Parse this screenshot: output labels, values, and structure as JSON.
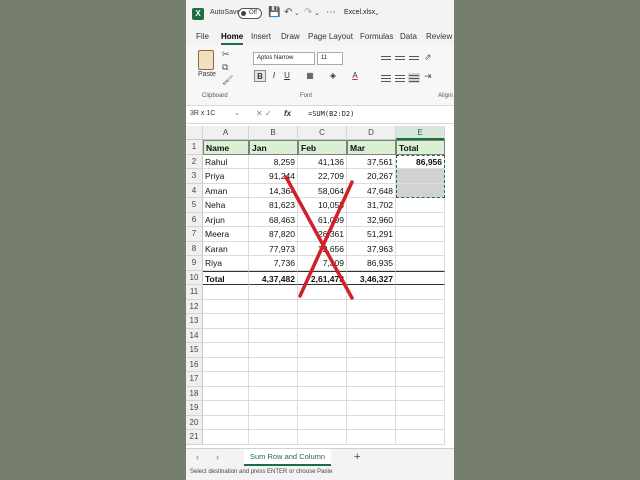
{
  "titlebar": {
    "autosave_label": "AutoSave",
    "toggle_state": "Off",
    "filename": "Excel.xlsx"
  },
  "menu": {
    "items": [
      "File",
      "Home",
      "Insert",
      "Draw",
      "Page Layout",
      "Formulas",
      "Data",
      "Review"
    ],
    "active": "Home"
  },
  "ribbon": {
    "paste_label": "Paste",
    "font_name": "Aptos Narrow",
    "font_size": "11",
    "groups": [
      "Clipboard",
      "Font",
      "Aligni"
    ]
  },
  "formula_bar": {
    "name_box": "3R x 1C",
    "formula": "=SUM(B2:D2)"
  },
  "columns": [
    "A",
    "B",
    "C",
    "D",
    "E"
  ],
  "rows": [
    "1",
    "2",
    "3",
    "4",
    "5",
    "6",
    "7",
    "8",
    "9",
    "10",
    "11",
    "12",
    "13",
    "14",
    "15",
    "16",
    "17",
    "18",
    "19",
    "20",
    "21"
  ],
  "table": {
    "headers": [
      "Name",
      "Jan",
      "Feb",
      "Mar",
      "Total"
    ],
    "data": [
      [
        "Rahul",
        "8,259",
        "41,136",
        "37,561",
        "86,956"
      ],
      [
        "Priya",
        "91,244",
        "22,709",
        "20,267",
        ""
      ],
      [
        "Aman",
        "14,364",
        "58,064",
        "47,648",
        ""
      ],
      [
        "Neha",
        "81,623",
        "10,055",
        "31,702",
        ""
      ],
      [
        "Arjun",
        "68,463",
        "61,099",
        "32,960",
        ""
      ],
      [
        "Meera",
        "87,820",
        "26,361",
        "51,291",
        ""
      ],
      [
        "Karan",
        "77,973",
        "22,656",
        "37,963",
        ""
      ],
      [
        "Riya",
        "7,736",
        "7,309",
        "86,935",
        ""
      ]
    ],
    "total_row": [
      "Total",
      "4,37,482",
      "2,61,473",
      "3,46,327",
      ""
    ]
  },
  "sheet_tab": "Sum Row and Column",
  "status_text": "Select destination and press ENTER or choose Paste",
  "colors": {
    "accent": "#1d6f42",
    "header_fill": "#d9f0d3",
    "cross_mark": "#d0202a"
  }
}
